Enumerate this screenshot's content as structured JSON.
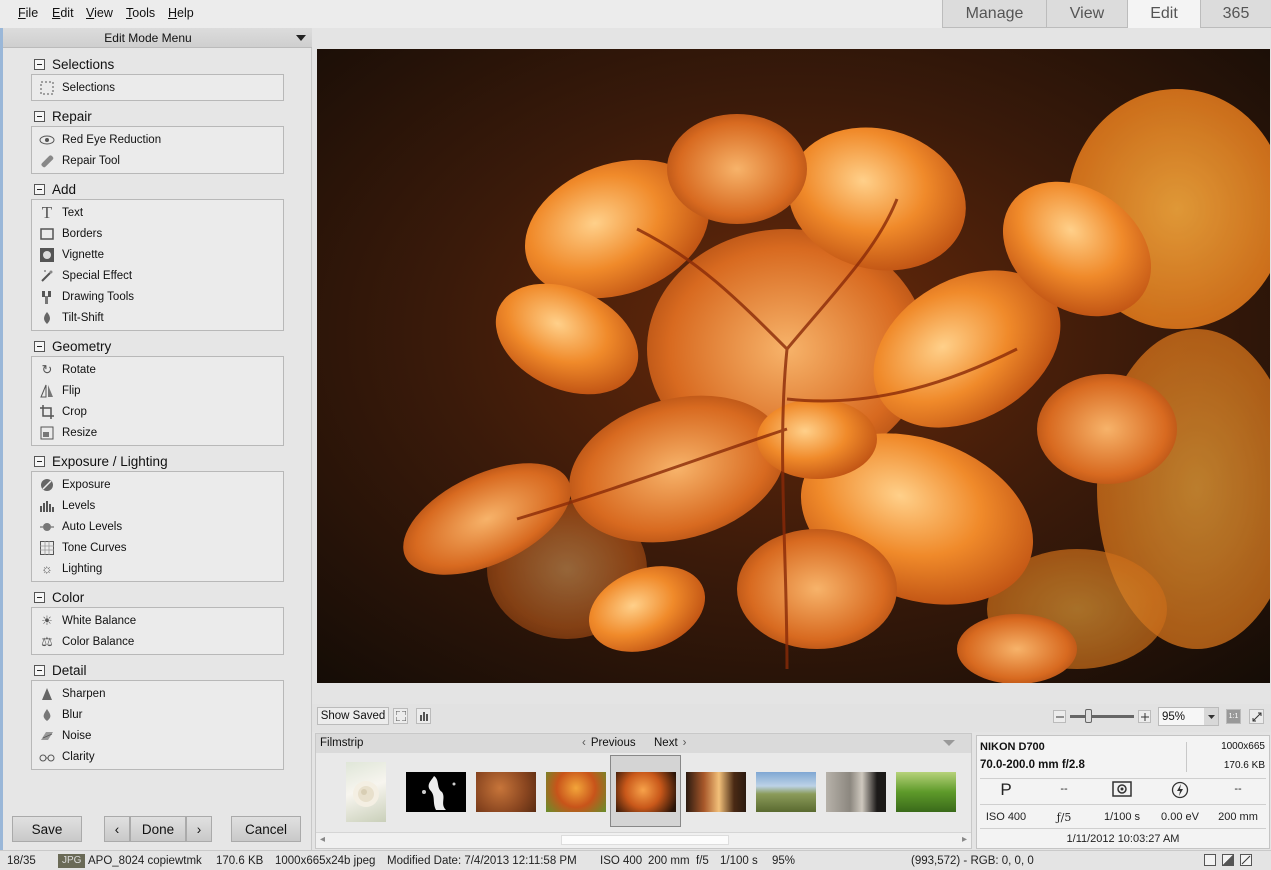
{
  "menu": {
    "file": "File",
    "edit": "Edit",
    "view": "View",
    "tools": "Tools",
    "help": "Help"
  },
  "mode_tabs": {
    "manage": "Manage",
    "view": "View",
    "edit": "Edit",
    "365": "365"
  },
  "panel": {
    "title": "Edit Mode Menu",
    "sections": [
      {
        "title": "Selections",
        "tools": [
          {
            "label": "Selections",
            "icon": "selection-icon"
          }
        ]
      },
      {
        "title": "Repair",
        "tools": [
          {
            "label": "Red Eye Reduction",
            "icon": "eye-icon"
          },
          {
            "label": "Repair Tool",
            "icon": "bandage-icon"
          }
        ]
      },
      {
        "title": "Add",
        "tools": [
          {
            "label": "Text",
            "icon": "text-icon"
          },
          {
            "label": "Borders",
            "icon": "border-icon"
          },
          {
            "label": "Vignette",
            "icon": "vignette-icon"
          },
          {
            "label": "Special Effect",
            "icon": "magic-wand-icon"
          },
          {
            "label": "Drawing Tools",
            "icon": "brush-icon"
          },
          {
            "label": "Tilt-Shift",
            "icon": "tilt-shift-icon"
          }
        ]
      },
      {
        "title": "Geometry",
        "tools": [
          {
            "label": "Rotate",
            "icon": "rotate-icon"
          },
          {
            "label": "Flip",
            "icon": "flip-icon"
          },
          {
            "label": "Crop",
            "icon": "crop-icon"
          },
          {
            "label": "Resize",
            "icon": "resize-icon"
          }
        ]
      },
      {
        "title": "Exposure / Lighting",
        "tools": [
          {
            "label": "Exposure",
            "icon": "exposure-icon"
          },
          {
            "label": "Levels",
            "icon": "levels-icon"
          },
          {
            "label": "Auto Levels",
            "icon": "auto-levels-icon"
          },
          {
            "label": "Tone Curves",
            "icon": "curves-icon"
          },
          {
            "label": "Lighting",
            "icon": "sun-icon"
          }
        ]
      },
      {
        "title": "Color",
        "tools": [
          {
            "label": "White Balance",
            "icon": "white-balance-icon"
          },
          {
            "label": "Color Balance",
            "icon": "scale-icon"
          }
        ]
      },
      {
        "title": "Detail",
        "tools": [
          {
            "label": "Sharpen",
            "icon": "sharpen-icon"
          },
          {
            "label": "Blur",
            "icon": "drop-icon"
          },
          {
            "label": "Noise",
            "icon": "noise-icon"
          },
          {
            "label": "Clarity",
            "icon": "glasses-icon"
          }
        ]
      }
    ]
  },
  "buttons": {
    "save": "Save",
    "prev": "‹",
    "done": "Done",
    "next": "›",
    "cancel": "Cancel"
  },
  "image_toolbar": {
    "show_saved": "Show Saved",
    "zoom_value": "95%",
    "zoom_one_to_one": "1:1",
    "zoom_slider_fraction": 0.28
  },
  "filmstrip": {
    "title": "Filmstrip",
    "previous": "Previous",
    "next": "Next",
    "selected_index": 4
  },
  "info": {
    "camera": "NIKON D700",
    "lens": "70.0-200.0 mm f/2.8",
    "dimensions": "1000x665",
    "filesize": "170.6 KB",
    "mode": "P",
    "exp_prog": "--",
    "flash_mode": "--",
    "iso": "ISO 400",
    "aperture": "ƒ/5",
    "shutter": "1/100 s",
    "ev": "0.00 eV",
    "focal": "200 mm",
    "datetime": "1/11/2012 10:03:27 AM"
  },
  "status": {
    "position": "18/35",
    "format": "JPG",
    "filename": "APO_8024 copiewtmk",
    "size": "170.6 KB",
    "dims": "1000x665x24b jpeg",
    "modified": "Modified Date: 7/4/2013 12:11:58 PM",
    "iso": "ISO 400",
    "focal": "200 mm",
    "aperture": "f/5",
    "shutter": "1/100 s",
    "zoom": "95%",
    "rgb": "(993,572) - RGB: 0, 0, 0"
  }
}
